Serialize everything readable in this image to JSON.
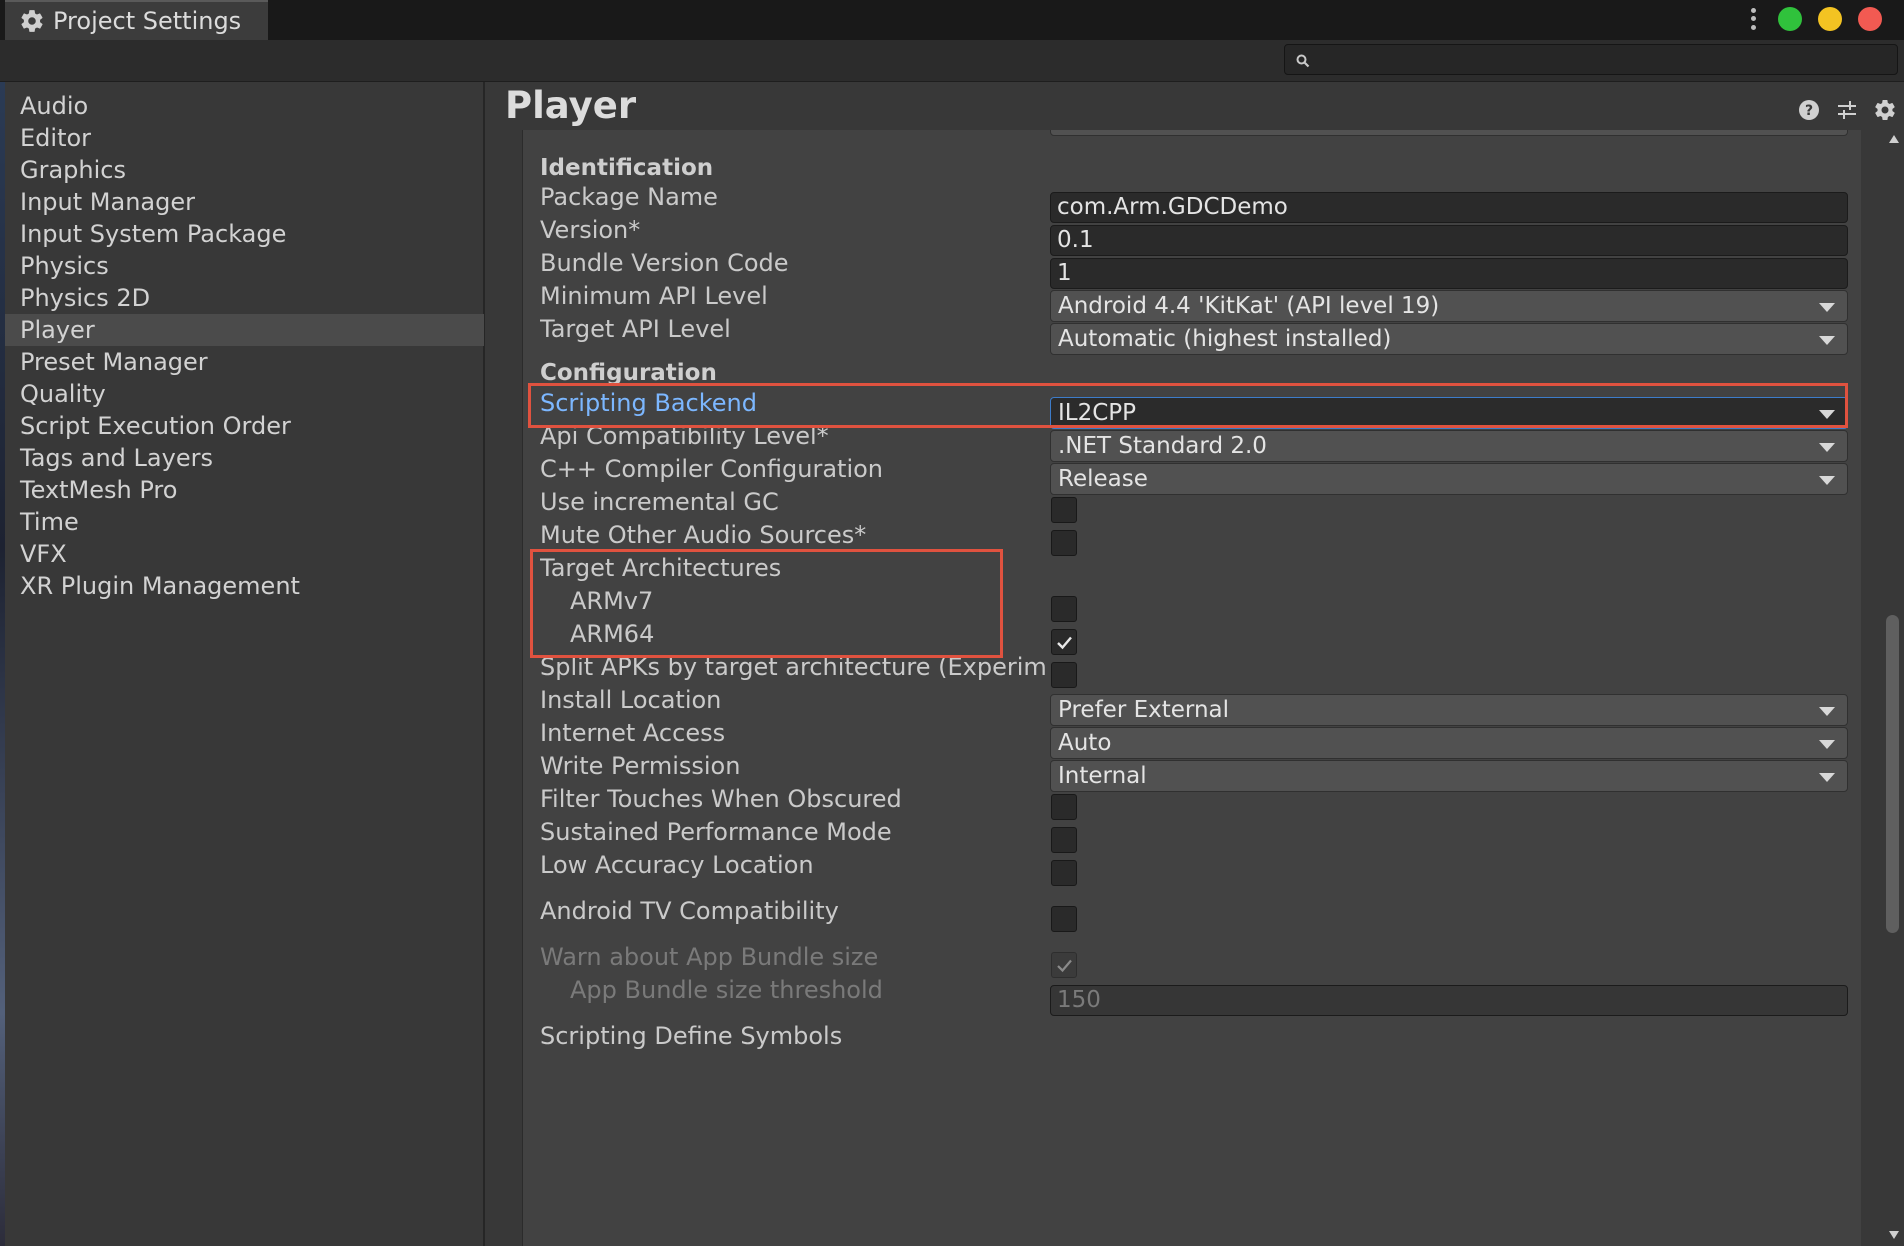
{
  "window": {
    "tab_title": "Project Settings",
    "window_controls": {
      "green": "#30c23c",
      "yellow": "#f3c322",
      "red": "#f25a52"
    }
  },
  "search": {
    "placeholder": ""
  },
  "sidebar": {
    "items": [
      {
        "label": "Audio"
      },
      {
        "label": "Editor"
      },
      {
        "label": "Graphics"
      },
      {
        "label": "Input Manager"
      },
      {
        "label": "Input System Package"
      },
      {
        "label": "Physics"
      },
      {
        "label": "Physics 2D"
      },
      {
        "label": "Player",
        "selected": true
      },
      {
        "label": "Preset Manager"
      },
      {
        "label": "Quality"
      },
      {
        "label": "Script Execution Order"
      },
      {
        "label": "Tags and Layers"
      },
      {
        "label": "TextMesh Pro"
      },
      {
        "label": "Time"
      },
      {
        "label": "VFX"
      },
      {
        "label": "XR Plugin Management"
      }
    ]
  },
  "main": {
    "title": "Player",
    "identification": {
      "heading": "Identification",
      "package_name": {
        "label": "Package Name",
        "value": "com.Arm.GDCDemo"
      },
      "version": {
        "label": "Version*",
        "value": "0.1"
      },
      "bundle_version_code": {
        "label": "Bundle Version Code",
        "value": "1"
      },
      "min_api": {
        "label": "Minimum API Level",
        "value": "Android 4.4 'KitKat' (API level 19)"
      },
      "target_api": {
        "label": "Target API Level",
        "value": "Automatic (highest installed)"
      }
    },
    "configuration": {
      "heading": "Configuration",
      "scripting_backend": {
        "label": "Scripting Backend",
        "value": "IL2CPP"
      },
      "api_compat": {
        "label": "Api Compatibility Level*",
        "value": ".NET Standard 2.0"
      },
      "cpp_config": {
        "label": "C++ Compiler Configuration",
        "value": "Release"
      },
      "incremental_gc": {
        "label": "Use incremental GC",
        "checked": false
      },
      "mute_audio": {
        "label": "Mute Other Audio Sources*",
        "checked": false
      },
      "target_arch": {
        "label": "Target Architectures"
      },
      "armv7": {
        "label": "ARMv7",
        "checked": false
      },
      "arm64": {
        "label": "ARM64",
        "checked": true
      },
      "split_apks": {
        "label": "Split APKs by target architecture (Experim",
        "checked": false
      },
      "install_location": {
        "label": "Install Location",
        "value": "Prefer External"
      },
      "internet_access": {
        "label": "Internet Access",
        "value": "Auto"
      },
      "write_permission": {
        "label": "Write Permission",
        "value": "Internal"
      },
      "filter_touches": {
        "label": "Filter Touches When Obscured",
        "checked": false
      },
      "sustained_perf": {
        "label": "Sustained Performance Mode",
        "checked": false
      },
      "low_accuracy": {
        "label": "Low Accuracy Location",
        "checked": false
      },
      "android_tv": {
        "label": "Android TV Compatibility",
        "checked": false
      },
      "warn_bundle": {
        "label": "Warn about App Bundle size",
        "checked": true
      },
      "bundle_threshold": {
        "label": "App Bundle size threshold",
        "value": "150"
      },
      "scripting_define": {
        "label": "Scripting Define Symbols"
      }
    }
  },
  "colors": {
    "highlight_box": "#e0523f",
    "focus_blue": "#3d7cc9",
    "label_blue": "#7cb7ff"
  },
  "icons": [
    "gear-icon",
    "search-icon",
    "help-icon",
    "preset-icon",
    "settings-icon",
    "checkmark-icon",
    "dropdown-caret-icon"
  ]
}
